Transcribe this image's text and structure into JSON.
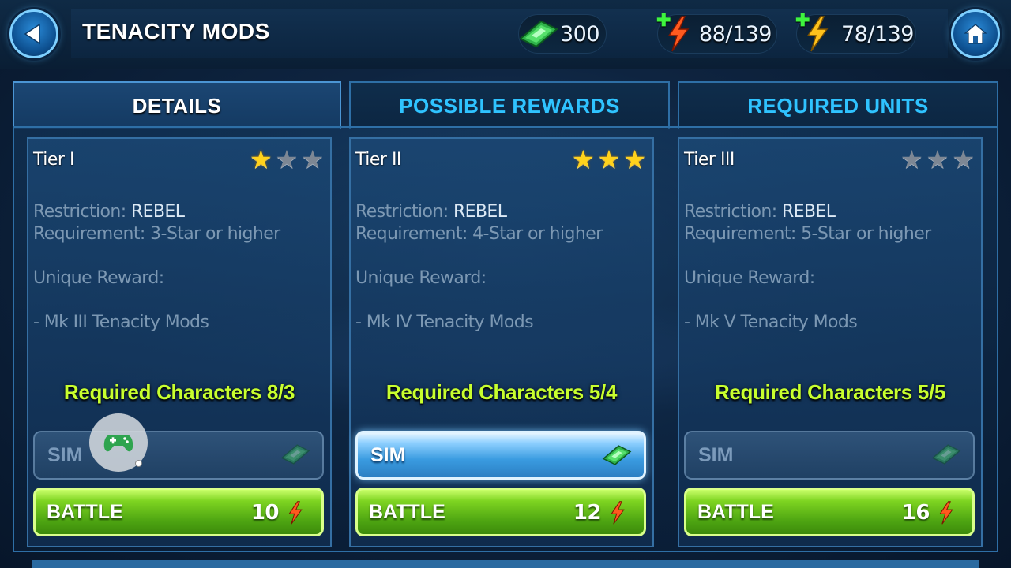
{
  "header": {
    "title": "TENACITY MODS",
    "resources": {
      "crystals": "300",
      "energy": "88/139",
      "cantina_energy": "78/139"
    }
  },
  "tabs": [
    {
      "label": "DETAILS",
      "active": true
    },
    {
      "label": "POSSIBLE REWARDS",
      "active": false
    },
    {
      "label": "REQUIRED UNITS",
      "active": false
    }
  ],
  "tiers": [
    {
      "name": "Tier I",
      "stars_earned": 1,
      "restriction_label": "Restriction:",
      "restriction_value": "REBEL",
      "requirement_label": "Requirement:",
      "requirement_value": "3-Star or higher",
      "unique_reward_label": "Unique Reward:",
      "unique_reward_item": "- Mk III Tenacity Mods",
      "required_characters": "Required Characters 8/3",
      "sim_label": "SIM",
      "sim_enabled": false,
      "battle_label": "BATTLE",
      "battle_cost": "10"
    },
    {
      "name": "Tier II",
      "stars_earned": 3,
      "restriction_label": "Restriction:",
      "restriction_value": "REBEL",
      "requirement_label": "Requirement:",
      "requirement_value": "4-Star or higher",
      "unique_reward_label": "Unique Reward:",
      "unique_reward_item": "- Mk IV Tenacity Mods",
      "required_characters": "Required Characters 5/4",
      "sim_label": "SIM",
      "sim_enabled": true,
      "battle_label": "BATTLE",
      "battle_cost": "12"
    },
    {
      "name": "Tier III",
      "stars_earned": 0,
      "restriction_label": "Restriction:",
      "restriction_value": "REBEL",
      "requirement_label": "Requirement:",
      "requirement_value": "5-Star or higher",
      "unique_reward_label": "Unique Reward:",
      "unique_reward_item": "- Mk V Tenacity Mods",
      "required_characters": "Required Characters 5/5",
      "sim_label": "SIM",
      "sim_enabled": false,
      "battle_label": "BATTLE",
      "battle_cost": "16"
    }
  ],
  "colors": {
    "accent_tab_text": "#2fc3ff",
    "required_text": "#c8ff2e",
    "battle_green": "#4ea512",
    "star_gold": "#ffd21c"
  },
  "icons": {
    "back": "back-arrow-icon",
    "home": "home-icon",
    "crystal": "crystal-icon",
    "energy": "energy-bolt-icon",
    "cantina_energy": "cantina-bolt-icon",
    "overlay": "gamepad-icon"
  }
}
